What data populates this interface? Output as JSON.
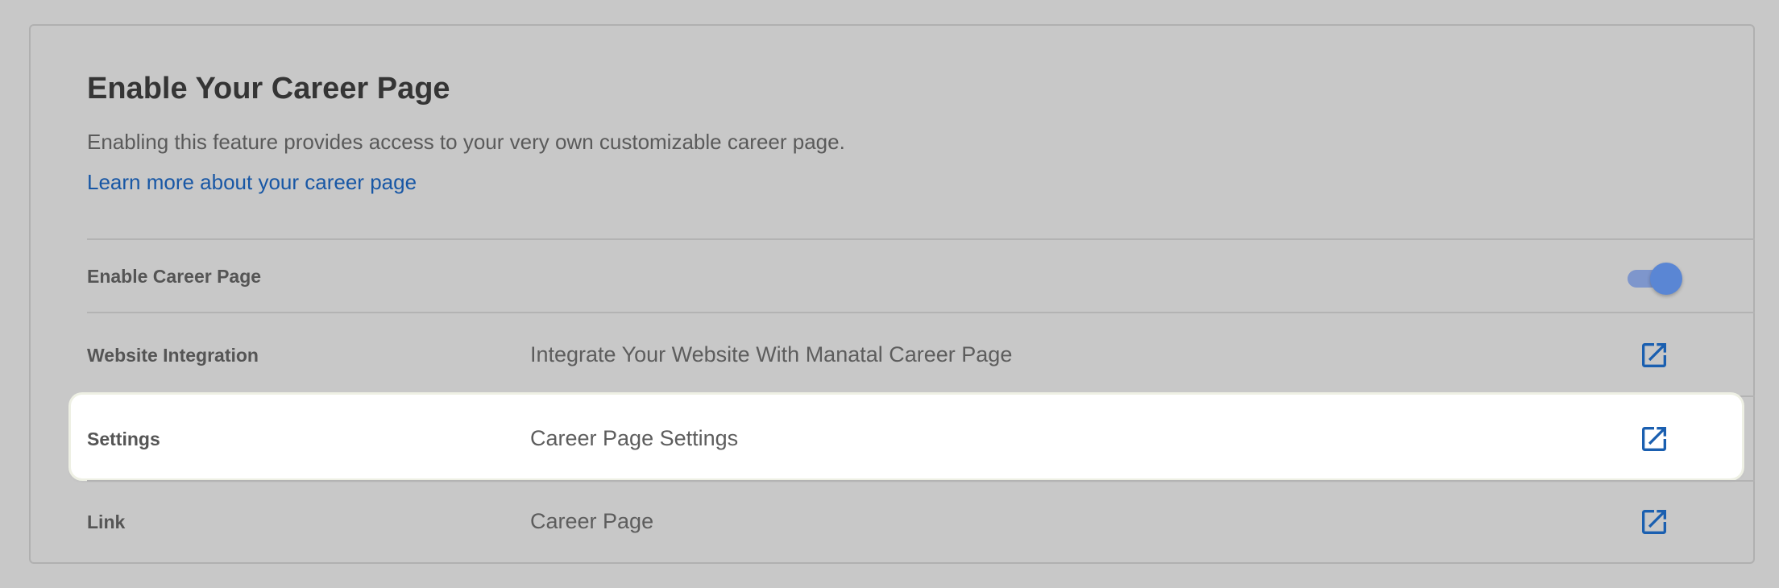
{
  "header": {
    "title": "Enable Your Career Page",
    "description": "Enabling this feature provides access to your very own customizable career page.",
    "learn_more_link": "Learn more about your career page"
  },
  "rows": [
    {
      "label": "Enable Career Page",
      "control": "toggle",
      "enabled": true
    },
    {
      "label": "Website Integration",
      "text": "Integrate Your Website With Manatal Career Page",
      "icon": "open-in-new-icon"
    },
    {
      "label": "Settings",
      "text": "Career Page Settings",
      "icon": "open-in-new-icon",
      "highlighted": true
    },
    {
      "label": "Link",
      "text": "Career Page",
      "icon": "open-in-new-icon"
    }
  ],
  "colors": {
    "background": "#c8c8c8",
    "link": "#1857a5",
    "icon": "#1a5fb0",
    "toggle_on": "#5a86d4",
    "highlight_row": "#ffffff"
  }
}
